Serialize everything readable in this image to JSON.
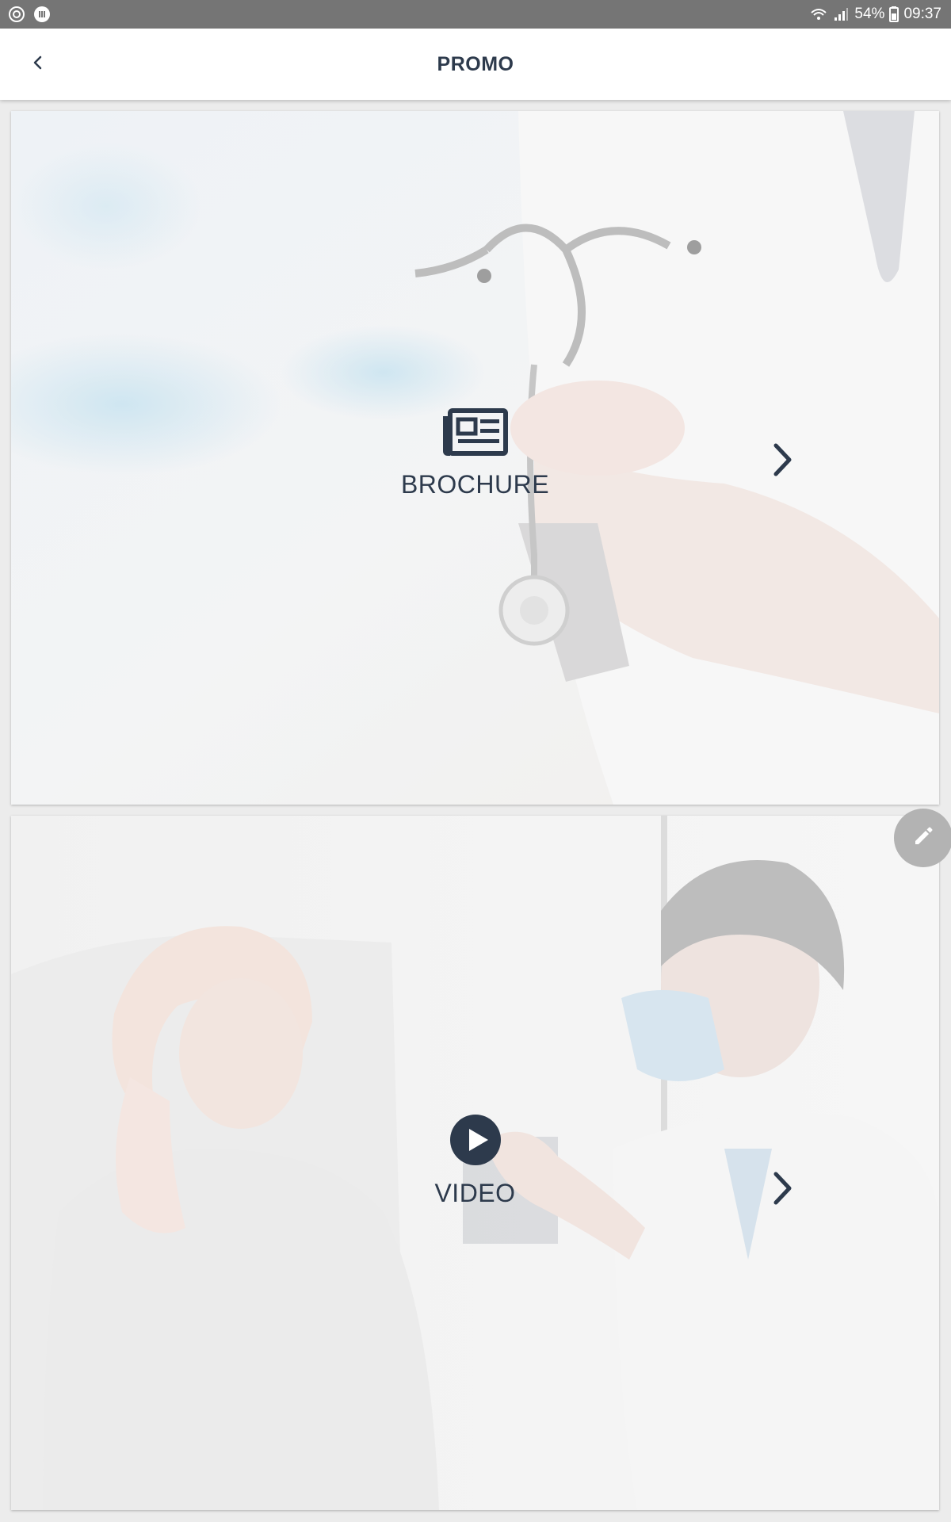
{
  "status_bar": {
    "battery": "54%",
    "time": "09:37",
    "icons": [
      "sync-icon",
      "media-icon",
      "wifi-icon",
      "signal-icon",
      "battery-icon"
    ]
  },
  "app_bar": {
    "title": "PROMO",
    "back_icon": "chevron-left-icon"
  },
  "cards": {
    "brochure": {
      "label": "BROCHURE",
      "icon": "newspaper-icon",
      "chevron": "chevron-right-icon"
    },
    "video": {
      "label": "VIDEO",
      "icon": "play-circle-icon",
      "chevron": "chevron-right-icon"
    }
  },
  "fab": {
    "icon": "pencil-icon"
  },
  "colors": {
    "text": "#2d3a4c",
    "status_bar": "#757575",
    "fab": "#b3b3b3"
  }
}
